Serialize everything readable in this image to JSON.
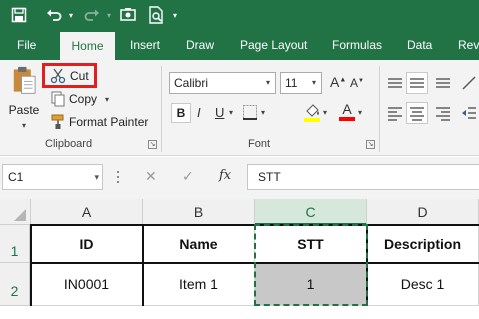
{
  "qat": {
    "save_icon": "save-icon",
    "undo_icon": "undo-icon",
    "redo_icon": "redo-icon",
    "touch_icon": "touch-mode-icon",
    "preview_icon": "print-preview-icon"
  },
  "tabs": [
    {
      "label": "File"
    },
    {
      "label": "Home"
    },
    {
      "label": "Insert"
    },
    {
      "label": "Draw"
    },
    {
      "label": "Page Layout"
    },
    {
      "label": "Formulas"
    },
    {
      "label": "Data"
    },
    {
      "label": "Rev"
    }
  ],
  "clipboard": {
    "paste_label": "Paste",
    "cut_label": "Cut",
    "copy_label": "Copy",
    "format_painter_label": "Format Painter",
    "group_label": "Clipboard"
  },
  "font": {
    "font_name": "Calibri",
    "font_size": "11",
    "bold": "B",
    "italic": "I",
    "underline": "U",
    "grow": "A",
    "shrink": "A",
    "font_color_glyph": "A",
    "group_label": "Font"
  },
  "colors": {
    "accent": "#217346",
    "highlight_red": "#e02020",
    "fill_yellow": "#ffff00",
    "font_red": "#ff0000",
    "selected_cell": "#c8c8c8"
  },
  "formula_bar": {
    "name_box": "C1",
    "cancel_glyph": "✕",
    "enter_glyph": "✓",
    "fx_label": "fx",
    "formula_value": "STT"
  },
  "grid": {
    "columns": [
      "A",
      "B",
      "C",
      "D"
    ],
    "rows": [
      "1",
      "2"
    ],
    "cells": [
      [
        "ID",
        "Name",
        "STT",
        "Description"
      ],
      [
        "IN0001",
        "Item 1",
        "1",
        "Desc 1"
      ]
    ]
  }
}
